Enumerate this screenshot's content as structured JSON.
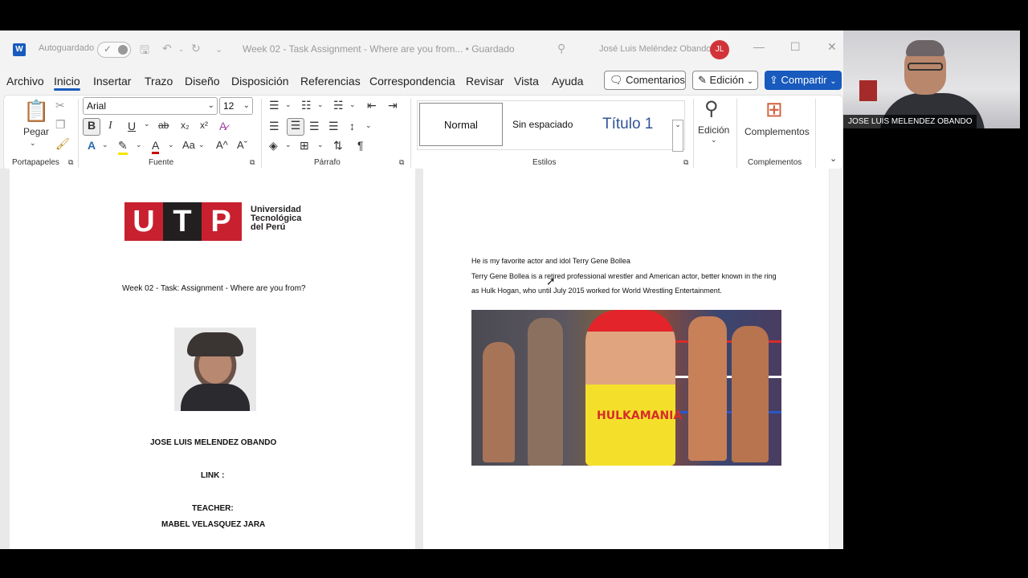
{
  "titlebar": {
    "app_icon_letter": "W",
    "autosave_label": "Autoguardado",
    "document_title": "Week 02 - Task  Assignment - Where are you from... • Guardado",
    "user_name": "José Luis Meléndez Obando",
    "avatar_initials": "JL"
  },
  "menu": {
    "items": [
      "Archivo",
      "Inicio",
      "Insertar",
      "Trazo",
      "Diseño",
      "Disposición",
      "Referencias",
      "Correspondencia",
      "Revisar",
      "Vista",
      "Ayuda"
    ],
    "active": "Inicio",
    "comments_label": "Comentarios",
    "edit_label": "Edición",
    "share_label": "Compartir"
  },
  "ribbon": {
    "paste_label": "Pegar",
    "clipboard_label": "Portapapeles",
    "font_name": "Arial",
    "font_size": "12",
    "font_group_label": "Fuente",
    "paragraph_label": "Párrafo",
    "styles": [
      "Normal",
      "Sin espaciado",
      "Título 1"
    ],
    "styles_label": "Estilos",
    "editing_label": "Edición",
    "addins_label": "Complementos",
    "addins_group_label": "Complementos"
  },
  "left_page": {
    "logo_letters": [
      "U",
      "T",
      "P"
    ],
    "logo_text_lines": [
      "Universidad",
      "Tecnológica",
      "del Perú"
    ],
    "assignment_title": "Week 02 - Task: Assignment - Where are you from?",
    "student_name": "JOSE LUIS MELENDEZ OBANDO",
    "link_label": "LINK :",
    "teacher_label": "TEACHER:",
    "teacher_name": "MABEL VELASQUEZ JARA"
  },
  "right_page": {
    "line1": "He is my favorite actor and idol Terry Gene Bollea",
    "line2": "Terry Gene Bollea is a retired professional wrestler and American actor, better known in the ring",
    "line3": "as Hulk Hogan, who until July 2015 worked for World Wrestling Entertainment.",
    "shirt_text": "HULKAMANIA"
  },
  "webcam": {
    "participant_name": "JOSE LUIS MELENDEZ OBANDO"
  }
}
